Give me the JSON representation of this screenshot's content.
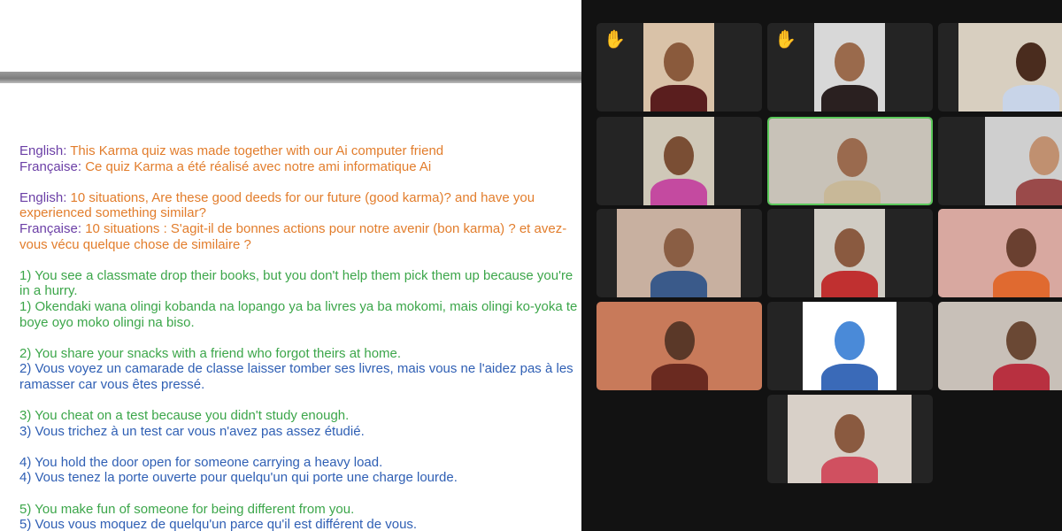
{
  "slide": {
    "intro_en_label": "English:",
    "intro_en": " This Karma quiz was made together with our Ai computer friend",
    "intro_fr_label": "Française:",
    "intro_fr": " Ce quiz Karma a été réalisé avec notre ami informatique Ai",
    "q_en_label": "English:",
    "q_en": " 10 situations, Are these good deeds for our future (good karma)? and have you experienced something similar?",
    "q_fr_label": "Française:",
    "q_fr": " 10 situations : S'agit-il de bonnes actions pour notre avenir (bon karma) ? et avez-vous vécu quelque chose de similaire ?",
    "items": [
      {
        "en": "1) You see a classmate drop their books, but you don't help them pick them up because you're in a hurry.",
        "fr": "1) Okendaki wana olingi kobanda na lopango ya ba livres ya ba mokomi, mais olingi ko-yoka te boye oyo moko olingi na biso."
      },
      {
        "en": "2) You share your snacks with a friend who forgot theirs at home.",
        "fr": "2) Vous voyez un camarade de classe laisser tomber ses livres, mais vous ne l'aidez pas à les ramasser car vous êtes pressé."
      },
      {
        "en": "3) You cheat on a test because you didn't study enough.",
        "fr": "3) Vous trichez à un test car vous n'avez pas assez étudié."
      },
      {
        "en": "4) You hold the door open for someone carrying a heavy load.",
        "fr": "4) Vous tenez la porte ouverte pour quelqu'un qui porte une charge lourde."
      },
      {
        "en": "5) You make fun of someone for being different from you.",
        "fr": "5) Vous vous moquez de quelqu'un parce qu'il est différent de vous."
      }
    ]
  },
  "gallery": {
    "raised_hand_icon": "✋",
    "active_color": "#5ac85a"
  }
}
